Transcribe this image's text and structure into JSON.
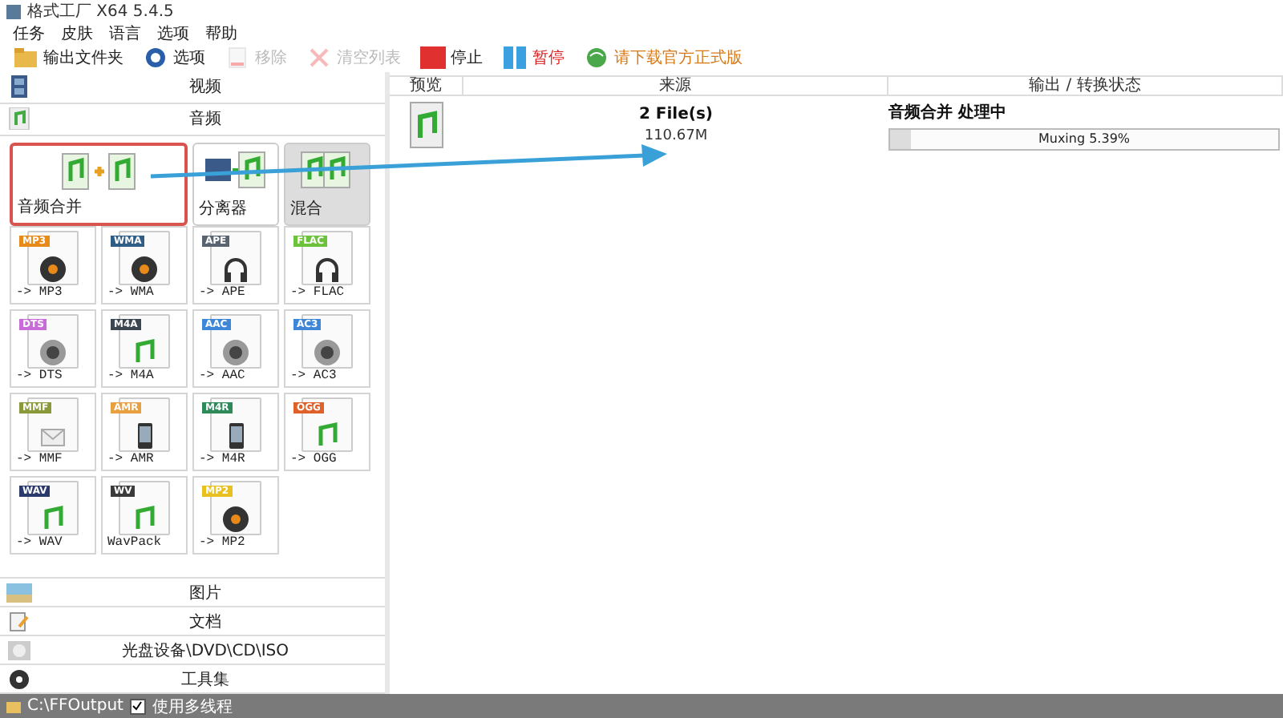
{
  "window": {
    "title": "格式工厂 X64 5.4.5"
  },
  "menu": [
    "任务",
    "皮肤",
    "语言",
    "选项",
    "帮助"
  ],
  "toolbar": [
    {
      "kind": "folder",
      "label": "输出文件夹",
      "disabled": false,
      "color": "#222222"
    },
    {
      "kind": "options",
      "label": "选项",
      "disabled": false,
      "color": "#222222"
    },
    {
      "kind": "remove",
      "label": "移除",
      "disabled": true,
      "color": "#bbbbbb"
    },
    {
      "kind": "clear",
      "label": "清空列表",
      "disabled": true,
      "color": "#bbbbbb"
    },
    {
      "kind": "stop",
      "label": "停止",
      "disabled": false,
      "color": "#222222"
    },
    {
      "kind": "pause",
      "label": "暂停",
      "disabled": false,
      "color": "#dd2222"
    },
    {
      "kind": "download",
      "label": "请下载官方正式版",
      "disabled": false,
      "color": "#d77a1a"
    }
  ],
  "sidebar": {
    "top": [
      {
        "kind": "video",
        "label": "视频"
      },
      {
        "kind": "audio",
        "label": "音频"
      }
    ],
    "tools": [
      {
        "kind": "merge",
        "label": "音频合并",
        "selected": false,
        "highlighted": true
      },
      {
        "kind": "splitter",
        "label": "分离器",
        "selected": false,
        "highlighted": false
      },
      {
        "kind": "mix",
        "label": "混合",
        "selected": true,
        "highlighted": false
      }
    ],
    "formats": [
      {
        "tag": "MP3",
        "label": "-> MP3",
        "color": "#e88a1a",
        "kind": "disc"
      },
      {
        "tag": "WMA",
        "label": "-> WMA",
        "color": "#2f5d86",
        "kind": "disc"
      },
      {
        "tag": "APE",
        "label": "-> APE",
        "color": "#5a6470",
        "kind": "headphones"
      },
      {
        "tag": "FLAC",
        "label": "-> FLAC",
        "color": "#6cc23a",
        "kind": "headphones"
      },
      {
        "tag": "DTS",
        "label": "-> DTS",
        "color": "#c86ad8",
        "kind": "speaker"
      },
      {
        "tag": "M4A",
        "label": "-> M4A",
        "color": "#3c4650",
        "kind": "note"
      },
      {
        "tag": "AAC",
        "label": "-> AAC",
        "color": "#3d86d8",
        "kind": "speaker"
      },
      {
        "tag": "AC3",
        "label": "-> AC3",
        "color": "#3d86d8",
        "kind": "speaker"
      },
      {
        "tag": "MMF",
        "label": "-> MMF",
        "color": "#8a9a3a",
        "kind": "mail"
      },
      {
        "tag": "AMR",
        "label": "-> AMR",
        "color": "#e8a040",
        "kind": "phone"
      },
      {
        "tag": "M4R",
        "label": "-> M4R",
        "color": "#2f8a5a",
        "kind": "phone"
      },
      {
        "tag": "OGG",
        "label": "-> OGG",
        "color": "#e0602a",
        "kind": "note"
      },
      {
        "tag": "WAV",
        "label": "-> WAV",
        "color": "#2a3a6a",
        "kind": "note"
      },
      {
        "tag": "WV",
        "label": "WavPack",
        "color": "#3a3a3a",
        "kind": "note"
      },
      {
        "tag": "MP2",
        "label": "-> MP2",
        "color": "#e8c020",
        "kind": "disc"
      }
    ],
    "bottom": [
      {
        "kind": "picture",
        "label": "图片"
      },
      {
        "kind": "document",
        "label": "文档"
      },
      {
        "kind": "disc",
        "label": "光盘设备\\DVD\\CD\\ISO"
      },
      {
        "kind": "tools",
        "label": "工具集"
      }
    ]
  },
  "table": {
    "columns": [
      "预览",
      "来源",
      "输出 / 转换状态"
    ],
    "rows": [
      {
        "source": "2 File(s)",
        "size": "110.67M",
        "status": "音频合并 处理中",
        "progress_text": "Muxing 5.39%",
        "level": 0.0539
      }
    ]
  },
  "status_bar": {
    "path": "C:\\FFOutput",
    "multithread": {
      "label": "使用多线程",
      "checked": true
    }
  }
}
